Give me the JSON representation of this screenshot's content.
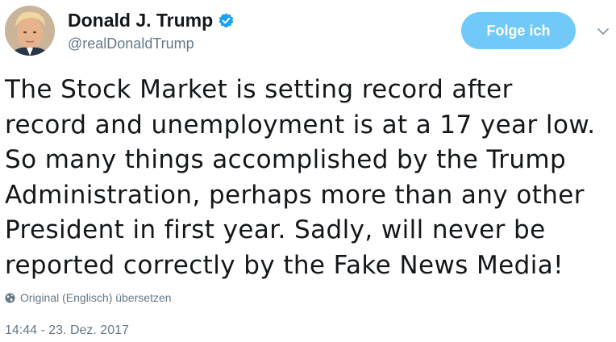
{
  "author": {
    "display_name": "Donald J. Trump",
    "handle": "@realDonaldTrump",
    "verified": true,
    "avatar_icon": "profile-photo",
    "verified_icon": "verified-badge-icon"
  },
  "actions": {
    "follow_label": "Folge ich",
    "more_icon": "chevron-down-icon"
  },
  "tweet": {
    "lines": [
      "The Stock Market is setting record after",
      "record and unemployment is at a 17 year low.",
      "So many things accomplished by the Trump",
      "Administration, perhaps more than any other",
      "President in first year. Sadly, will never be",
      "reported correctly by the Fake News Media!"
    ],
    "translate_label": "Original (Englisch) übersetzen",
    "translate_icon": "globe-icon",
    "timestamp": "14:44 - 23. Dez. 2017"
  },
  "colors": {
    "accent": "#1da1f2",
    "follow_button_bg": "#71c9f8",
    "secondary_text": "#657786",
    "primary_text": "#14171a"
  }
}
